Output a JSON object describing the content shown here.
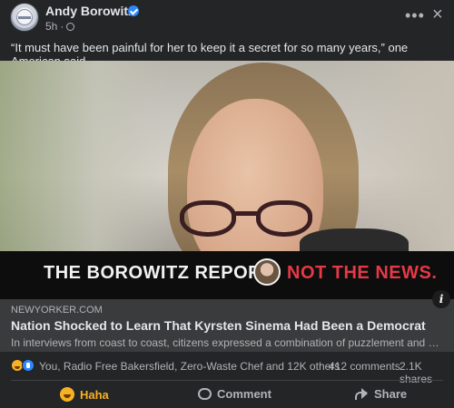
{
  "post": {
    "author": "Andy Borowitz",
    "time": "5h",
    "caption": "“It must have been painful for her to keep it a secret for so many years,” one American said."
  },
  "icons": {
    "verified": "verified-badge-icon",
    "audience": "globe-icon",
    "more": "more-options-icon",
    "close": "close-icon",
    "info": "info-icon"
  },
  "banner": {
    "left_text": "THE BOROWITZ REPORT",
    "right_text": "NOT THE NEWS."
  },
  "link": {
    "domain": "NEWYORKER.COM",
    "title": "Nation Shocked to Learn That Kyrsten Sinema Had Been a Democrat",
    "description": "In interviews from coast to coast, citizens expressed a combination of puzzlement and disbelief."
  },
  "stats": {
    "reactors": "You, Radio Free Bakersfield, Zero-Waste Chef and 12K others",
    "comments": "412 comments",
    "shares": "2.1K shares"
  },
  "actions": {
    "haha": "Haha",
    "comment": "Comment",
    "share": "Share"
  },
  "colors": {
    "background": "#242526",
    "text": "#e4e6eb",
    "muted": "#b0b3b8",
    "accent_blue": "#2d88ff",
    "haha_yellow": "#f7b125",
    "banner_red": "#e53946"
  }
}
